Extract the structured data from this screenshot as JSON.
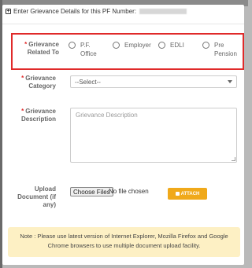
{
  "header": {
    "icon": "plus-square-icon",
    "title": "Enter Grievance Details for this PF Number:"
  },
  "grievance_related_to": {
    "label_line1": "Grievance",
    "label_line2": "Related To",
    "required_mark": "*",
    "options": [
      {
        "line1": "P.F.",
        "line2": "Office"
      },
      {
        "line1": "Employer",
        "line2": ""
      },
      {
        "line1": "EDLI",
        "line2": ""
      },
      {
        "line1": "Pre",
        "line2": "Pension"
      }
    ]
  },
  "grievance_category": {
    "label_line1": "Grievance",
    "label_line2": "Category",
    "required_mark": "*",
    "selected": "--Select--"
  },
  "grievance_description": {
    "label_line1": "Grievance",
    "label_line2": "Description",
    "required_mark": "*",
    "placeholder": "Grievance Description"
  },
  "upload_document": {
    "label_line1": "Upload",
    "label_line2": "Document (if",
    "label_line3": "any)",
    "choose_button": "Choose Files",
    "status": "No file chosen",
    "attach_button": "ATTACH",
    "attach_icon": "attach-icon"
  },
  "note": "Note : Please use latest version of Internet Explorer, Mozilla Firefox and Google Chrome browsers to use multiple document upload facility.",
  "colors": {
    "highlight_border": "#e02a2a",
    "attach_button": "#f0a91a",
    "note_background": "#fdf0c4",
    "required_star": "#e02a2a"
  }
}
